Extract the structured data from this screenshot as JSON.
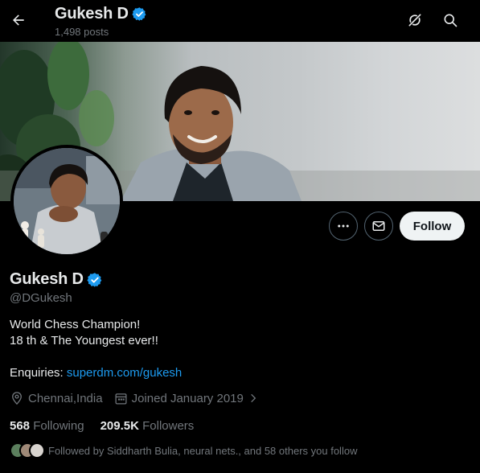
{
  "header": {
    "title": "Gukesh D",
    "posts_count": "1,498 posts"
  },
  "profile": {
    "name": "Gukesh D",
    "handle": "@DGukesh",
    "bio_line1": "World Chess Champion!",
    "bio_line2": "18 th & The Youngest ever!!",
    "enquiries_label": "Enquiries: ",
    "enquiries_link": "superdm.com/gukesh",
    "location": "Chennai,India",
    "joined": "Joined January 2019",
    "following_count": "568",
    "following_label": "Following",
    "followers_count": "209.5K",
    "followers_label": "Followers",
    "followed_by": "Followed by Siddharth Bulia, neural nets., and 58 others you follow"
  },
  "buttons": {
    "follow_label": "Follow"
  },
  "colors": {
    "background": "#000000",
    "text_primary": "#e7e9ea",
    "text_secondary": "#71767b",
    "accent_link": "#1d9bf0",
    "verified": "#1d9bf0",
    "follow_button_bg": "#eff3f4"
  },
  "icons": [
    "back-arrow-icon",
    "grok-icon",
    "search-icon",
    "verified-badge-icon",
    "more-icon",
    "mail-icon",
    "location-icon",
    "calendar-icon",
    "chevron-right-icon"
  ]
}
